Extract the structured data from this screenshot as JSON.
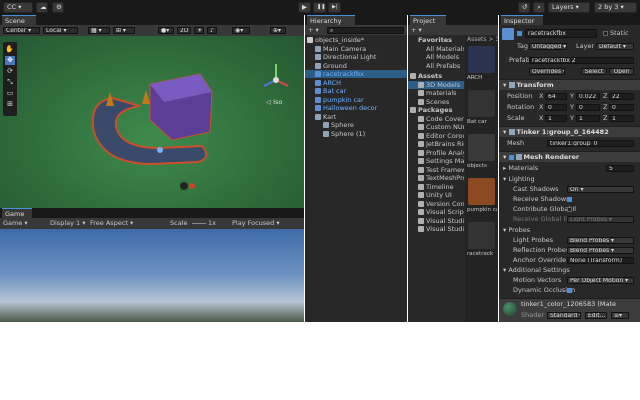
{
  "toolbar": {
    "account": "CC",
    "play": "▶",
    "pause": "❚❚",
    "step": "▶|",
    "layers": "Layers",
    "layout": "2 by 3",
    "cloud": "☁",
    "search": "⚙"
  },
  "scene": {
    "tab": "Scene",
    "center": "Center",
    "local": "Local",
    "mode2d": "2D",
    "persp": "◁ Iso"
  },
  "game": {
    "tab": "Game",
    "game_dd": "Game",
    "display": "Display 1",
    "aspect": "Free Aspect",
    "scale_label": "Scale",
    "scale_val": "1x",
    "play_focused": "Play Focused"
  },
  "hierarchy": {
    "tab": "Hierarchy",
    "items": [
      {
        "label": "objects_inside*",
        "depth": 0,
        "kind": "scene"
      },
      {
        "label": "Main Camera",
        "depth": 1,
        "kind": "cube"
      },
      {
        "label": "Directional Light",
        "depth": 1,
        "kind": "cube"
      },
      {
        "label": "Ground",
        "depth": 1,
        "kind": "cube"
      },
      {
        "label": "racetrackfbx",
        "depth": 1,
        "kind": "prefab",
        "selected": true
      },
      {
        "label": "ARCH",
        "depth": 1,
        "kind": "prefab"
      },
      {
        "label": "Bat car",
        "depth": 1,
        "kind": "prefab"
      },
      {
        "label": "pumpkin car",
        "depth": 1,
        "kind": "prefab"
      },
      {
        "label": "Halloween decor",
        "depth": 1,
        "kind": "prefab"
      },
      {
        "label": "Kart",
        "depth": 1,
        "kind": "cube"
      },
      {
        "label": "Sphere",
        "depth": 2,
        "kind": "cube"
      },
      {
        "label": "Sphere (1)",
        "depth": 2,
        "kind": "cube"
      }
    ]
  },
  "project": {
    "tab": "Project",
    "favorites": "Favorites",
    "fav_items": [
      "All Materials",
      "All Models",
      "All Prefabs"
    ],
    "assets": "Assets",
    "asset_items": [
      "3D Models",
      "materials",
      "Scenes"
    ],
    "packages": "Packages",
    "package_items": [
      "Code Coverage",
      "Custom NUnit",
      "Editor Coroutines",
      "JetBrains Rider",
      "Profile Analyzer",
      "Settings Manager",
      "Test Framework",
      "TextMeshPro",
      "Timeline",
      "Unity UI",
      "Version Control",
      "Visual Scripting",
      "Visual Studio",
      "Visual Studio"
    ],
    "breadcrumb": "Assets > 3D",
    "thumbs": [
      "ARCH",
      "Bat car",
      "objects",
      "pumpkin car",
      "racetrack"
    ]
  },
  "inspector": {
    "tab": "Inspector",
    "name": "racetrackfbx",
    "static": "Static",
    "tag_label": "Tag",
    "tag": "Untagged",
    "layer_label": "Layer",
    "layer": "Default",
    "prefab_label": "Prefab",
    "prefab": "racetrackfbx 2",
    "overrides": "Overrides",
    "select": "Select",
    "open": "Open",
    "transform": "Transform",
    "position_label": "Position",
    "pos": {
      "x": "64",
      "y": "0.022",
      "z": "22"
    },
    "rotation_label": "Rotation",
    "rot": {
      "x": "0",
      "y": "0",
      "z": "0"
    },
    "scale_label": "Scale",
    "scl": {
      "x": "1",
      "y": "1",
      "z": "1"
    },
    "meshfilter": "Tinker 1:group_0_164482",
    "mesh_label": "Mesh",
    "mesh": "tinker1:group_0_",
    "meshrenderer": "Mesh Renderer",
    "materials_label": "Materials",
    "materials_count": "5",
    "lighting": "Lighting",
    "cast_shadows_label": "Cast Shadows",
    "cast_shadows": "On",
    "receive_shadows_label": "Receive Shadows",
    "contribute_gi_label": "Contribute Global Il",
    "receive_gi_label": "Receive Global Illu",
    "receive_gi": "Light Probes",
    "probes": "Probes",
    "light_probes_label": "Light Probes",
    "light_probes": "Blend Probes",
    "reflection_probes_label": "Reflection Probes",
    "reflection_probes": "Blend Probes",
    "anchor_label": "Anchor Override",
    "anchor": "None (Transform)",
    "additional": "Additional Settings",
    "motion_label": "Motion Vectors",
    "motion": "Per Object Motion",
    "dynamic_label": "Dynamic Occlusion",
    "material_name": "tinker1_color_1206583 (Mate",
    "shader_label": "Shader",
    "shader": "Standard",
    "edit": "Edit..."
  }
}
